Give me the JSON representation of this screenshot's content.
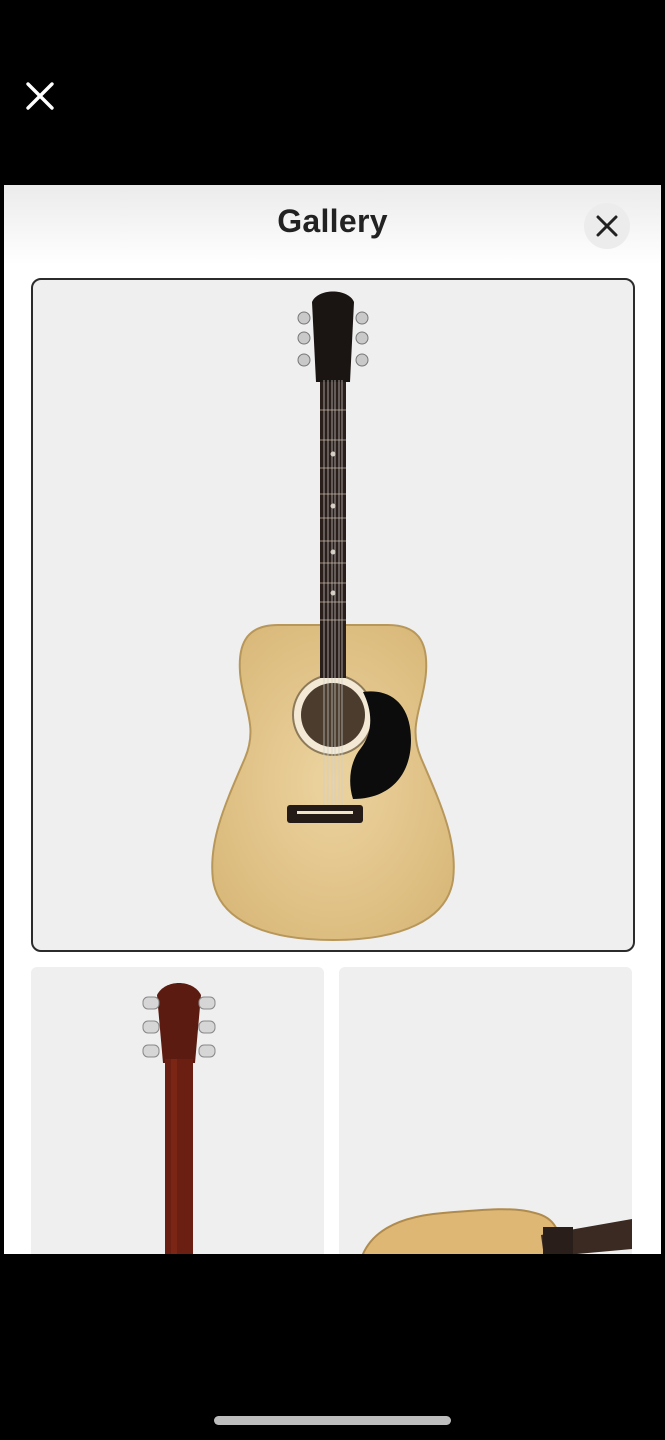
{
  "viewer": {
    "close_icon": "close-icon"
  },
  "gallery": {
    "title": "Gallery",
    "close_icon": "close-icon",
    "images": [
      {
        "subject": "acoustic-guitar-front",
        "selected": true
      },
      {
        "subject": "guitar-headstock-back",
        "selected": false
      },
      {
        "subject": "guitar-body-angle",
        "selected": false
      }
    ]
  },
  "colors": {
    "backdrop": "#000000",
    "sheet": "#ffffff",
    "image_bg": "#efefef",
    "guitar_top": "#e4c78f",
    "fretboard": "#2a1e1a",
    "back_wood": "#6b1f12"
  }
}
